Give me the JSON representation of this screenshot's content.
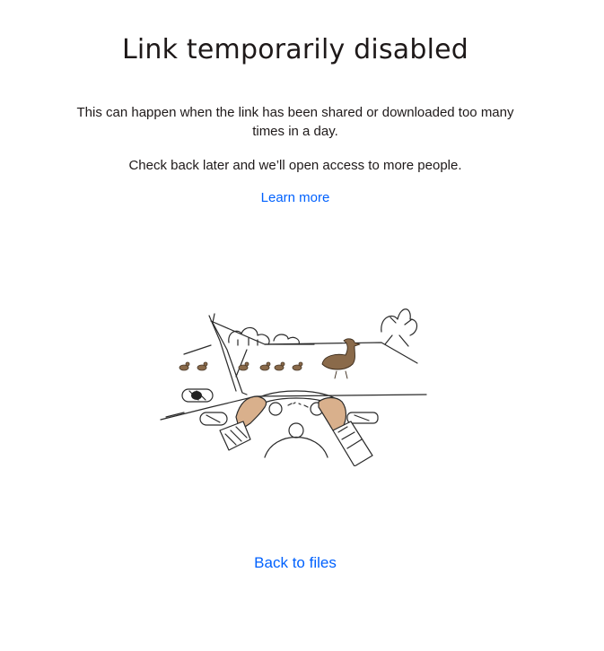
{
  "heading": "Link temporarily disabled",
  "message": {
    "line1": "This can happen when the link has been shared or downloaded too many",
    "line2": "times in a day.",
    "line3": "Check back later and we’ll open access to more people."
  },
  "learn_more_label": "Learn more",
  "back_label": "Back to files",
  "illustration": {
    "subject": "driver-stopped-for-ducks-illustration"
  },
  "colors": {
    "link": "#0061fe",
    "text": "#1e1919",
    "skin": "#d9b08c",
    "duck": "#8a6a4a"
  }
}
